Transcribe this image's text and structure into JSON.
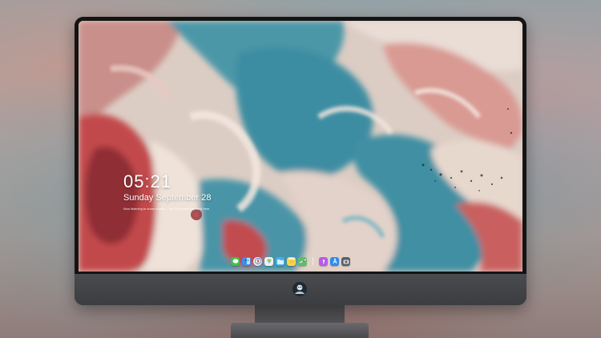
{
  "lock_screen": {
    "time": "05:21",
    "date": "Sunday September  28",
    "status_line": "Now listening to some music — tap to resume playback here"
  },
  "dock": {
    "items": [
      {
        "icon": "messages-icon",
        "color": "#3fc14d"
      },
      {
        "icon": "finder-icon",
        "color": "#3a8fe8"
      },
      {
        "icon": "safari-icon",
        "color": "#e9e9e9"
      },
      {
        "icon": "photos-icon",
        "color": "#f0f0f0"
      },
      {
        "icon": "files-icon",
        "color": "#4ab0e8"
      },
      {
        "icon": "notes-icon",
        "color": "#f7d64a"
      },
      {
        "icon": "maps-icon",
        "color": "#5cbf6a"
      },
      {
        "icon": "podcasts-icon",
        "color": "#b65be8"
      },
      {
        "icon": "appstore-icon",
        "color": "#2f8cf0"
      },
      {
        "icon": "camera-icon",
        "color": "#5b5f66"
      }
    ]
  },
  "colors": {
    "bezel": "#141414",
    "chin": "#45464a",
    "wallpaper_teal": "#3f8fa3",
    "wallpaper_red": "#c2484c",
    "wallpaper_cream": "#e7d8ce"
  }
}
